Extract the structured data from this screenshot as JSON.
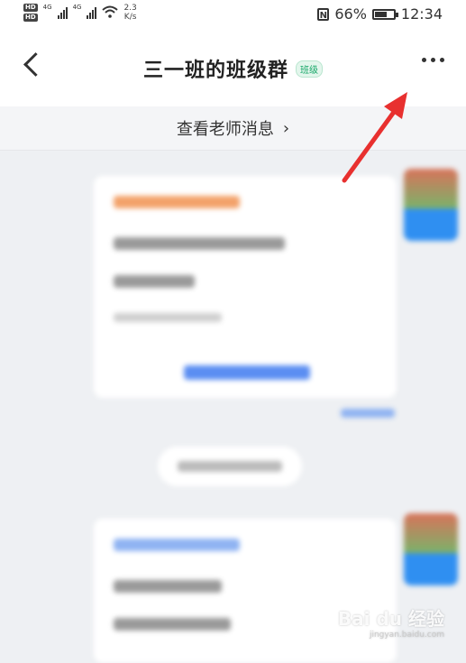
{
  "status_bar": {
    "hd_label": "HD",
    "network_label": "4G",
    "speed_value": "2.3",
    "speed_unit": "K/s",
    "nfc_label": "N",
    "battery_percent": "66%",
    "battery_fill": 0.66,
    "time": "12:34"
  },
  "navbar": {
    "title": "三一班的班级群",
    "badge": "班级"
  },
  "teacher_bar": {
    "label": "查看老师消息",
    "chevron": "›"
  },
  "annotation": {
    "arrow_color": "#e8302f"
  },
  "watermark": {
    "brand": "Bai du 经验",
    "url": "jingyan.baidu.com"
  },
  "colors": {
    "accent": "#1aa86a",
    "blue": "#2f8ff1"
  }
}
